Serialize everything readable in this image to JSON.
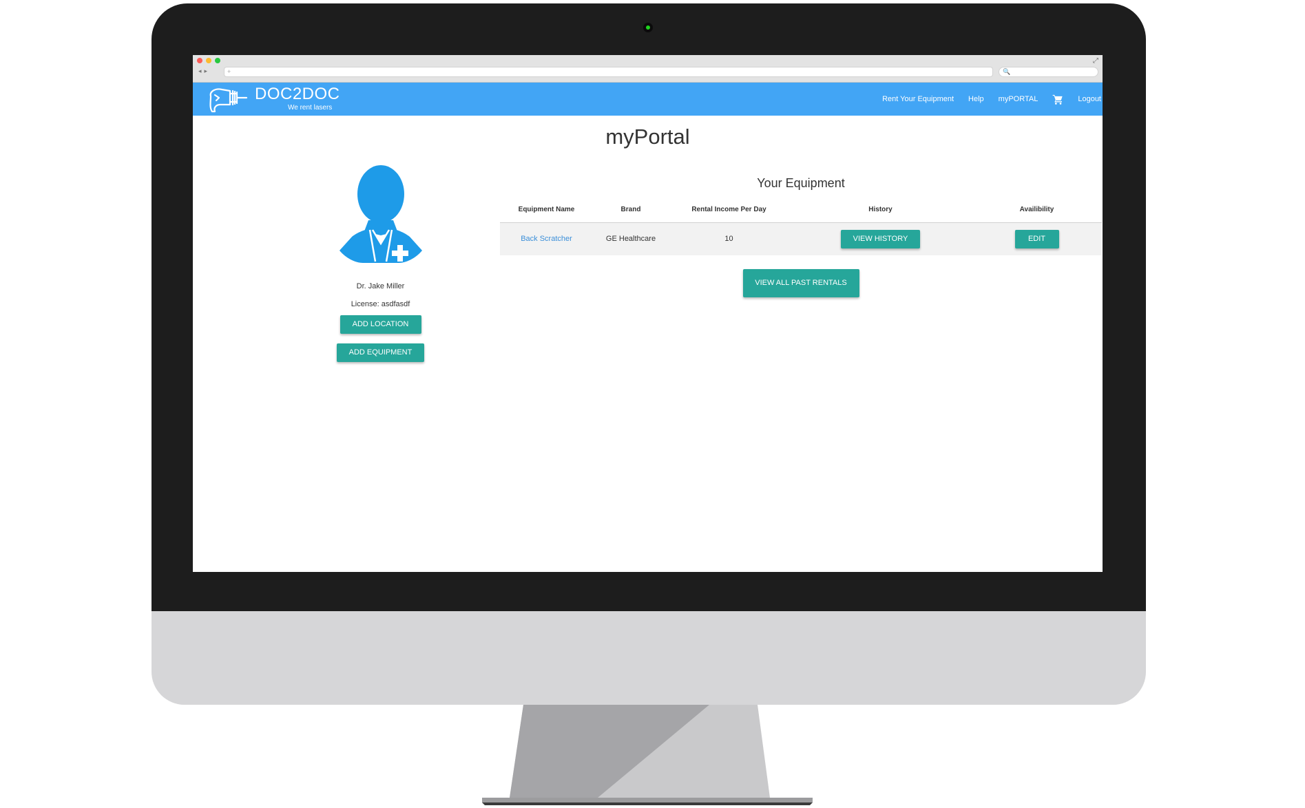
{
  "browser": {
    "address_placeholder": "+",
    "search_placeholder": "🔍"
  },
  "header": {
    "brand_name": "DOC2DOC",
    "tagline": "We rent lasers",
    "nav": [
      {
        "label": "Rent Your Equipment"
      },
      {
        "label": "Help"
      },
      {
        "label": "myPORTAL"
      },
      {
        "label": "Logout"
      }
    ],
    "cart_icon": "cart-icon"
  },
  "page": {
    "title": "myPortal"
  },
  "profile": {
    "name": "Dr. Jake Miller",
    "license": "License: asdfasdf",
    "add_location_label": "ADD LOCATION",
    "add_equipment_label": "ADD EQUIPMENT"
  },
  "equipment": {
    "title": "Your Equipment",
    "columns": [
      "Equipment Name",
      "Brand",
      "Rental Income Per Day",
      "History",
      "Availibility"
    ],
    "rows": [
      {
        "name": "Back Scratcher",
        "brand": "GE Healthcare",
        "income": "10",
        "history_label": "VIEW HISTORY",
        "availability_label": "EDIT"
      }
    ],
    "view_past_label": "VIEW ALL PAST RENTALS"
  },
  "colors": {
    "header_blue": "#42a5f5",
    "teal_button": "#26a69a",
    "avatar_blue": "#1e9be8",
    "link_blue": "#3b8fd9"
  }
}
